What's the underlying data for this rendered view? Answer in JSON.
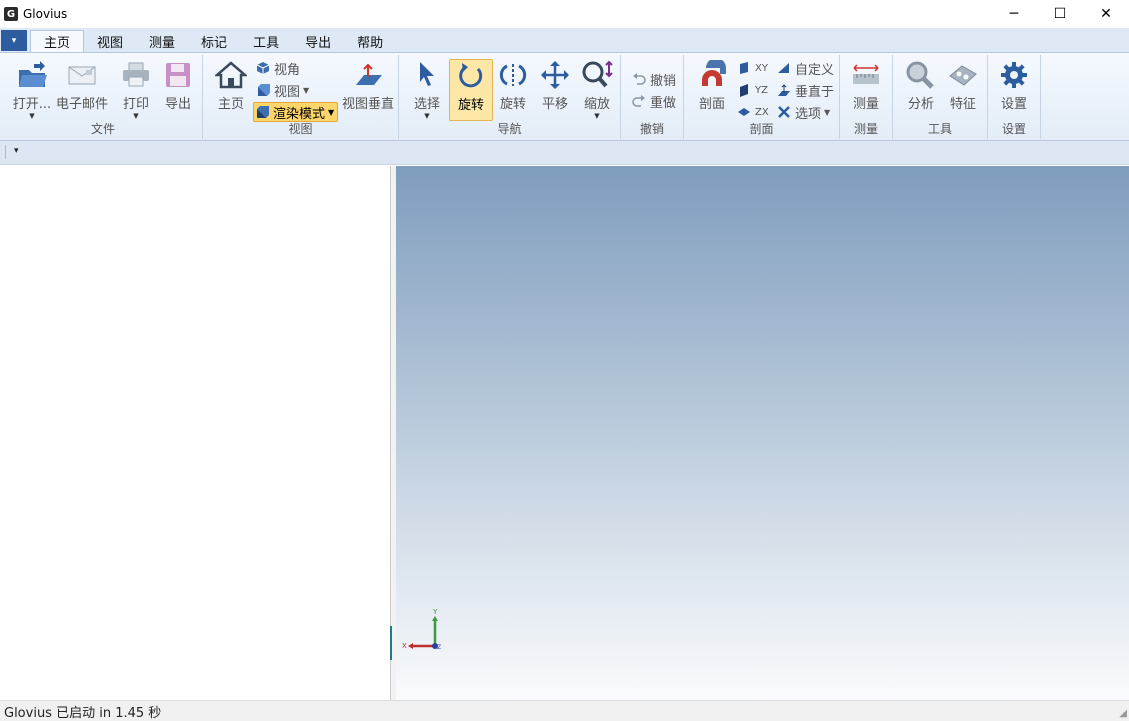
{
  "window": {
    "title": "Glovius",
    "app_icon_letter": "G",
    "controls": {
      "minimize": "─",
      "maximize": "☐",
      "close": "✕"
    }
  },
  "ribbon_tabs": [
    {
      "label": "主页",
      "active": true
    },
    {
      "label": "视图",
      "active": false
    },
    {
      "label": "测量",
      "active": false
    },
    {
      "label": "标记",
      "active": false
    },
    {
      "label": "工具",
      "active": false
    },
    {
      "label": "导出",
      "active": false
    },
    {
      "label": "帮助",
      "active": false
    }
  ],
  "groups": {
    "file": {
      "label": "文件",
      "open": "打开...",
      "email": "电子邮件",
      "print": "打印",
      "export": "导出"
    },
    "view": {
      "label": "视图",
      "home": "主页",
      "angle": "视角",
      "views": "视图",
      "render_mode": "渲染模式",
      "view_normal": "视图垂直"
    },
    "navigation": {
      "label": "导航",
      "select": "选择",
      "rotate": "旋转",
      "spin": "旋转",
      "pan": "平移",
      "zoom": "缩放"
    },
    "undo": {
      "label": "撤销",
      "undo": "撤销",
      "redo": "重做"
    },
    "section": {
      "label": "剖面",
      "section": "剖面",
      "xy": "XY",
      "yz": "YZ",
      "zx": "ZX",
      "custom": "自定义",
      "perpendicular": "垂直于",
      "options": "选项"
    },
    "measure": {
      "label": "测量",
      "measure": "测量"
    },
    "tools": {
      "label": "工具",
      "analyze": "分析",
      "features": "特征"
    },
    "settings": {
      "label": "设置",
      "settings": "设置"
    }
  },
  "triad": {
    "x": "X",
    "y": "Y",
    "z": "Z"
  },
  "status": {
    "text": "Glovius 已启动 in 1.45 秒"
  },
  "colors": {
    "accent": "#2d5d9f",
    "selected_button": "#fde7a6",
    "viewport_top": "#7f9dbd",
    "viewport_bottom": "#fafbfd"
  }
}
